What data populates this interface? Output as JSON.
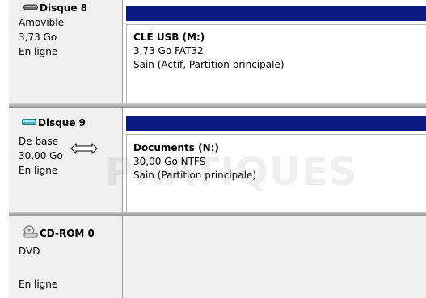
{
  "disks": [
    {
      "name": "Disque 8",
      "type": "Amovible",
      "size": "3,73 Go",
      "status": "En ligne",
      "icon": "removable-disk-icon",
      "partition": {
        "name": "CLÉ USB  (M:)",
        "size_fs": "3,73 Go FAT32",
        "health": "Sain (Actif, Partition principale)"
      }
    },
    {
      "name": "Disque 9",
      "type": "De base",
      "size": "30,00 Go",
      "status": "En ligne",
      "icon": "basic-disk-icon",
      "partition": {
        "name": "Documents  (N:)",
        "size_fs": "30,00 Go NTFS",
        "health": "Sain (Partition principale)"
      }
    },
    {
      "name": "CD-ROM 0",
      "type": "DVD",
      "status": "En ligne",
      "icon": "cdrom-icon"
    }
  ],
  "colors": {
    "partition_bar": "#0a1b86",
    "info_bg": "#f0f0f0"
  },
  "watermark": "PRATIQUES"
}
